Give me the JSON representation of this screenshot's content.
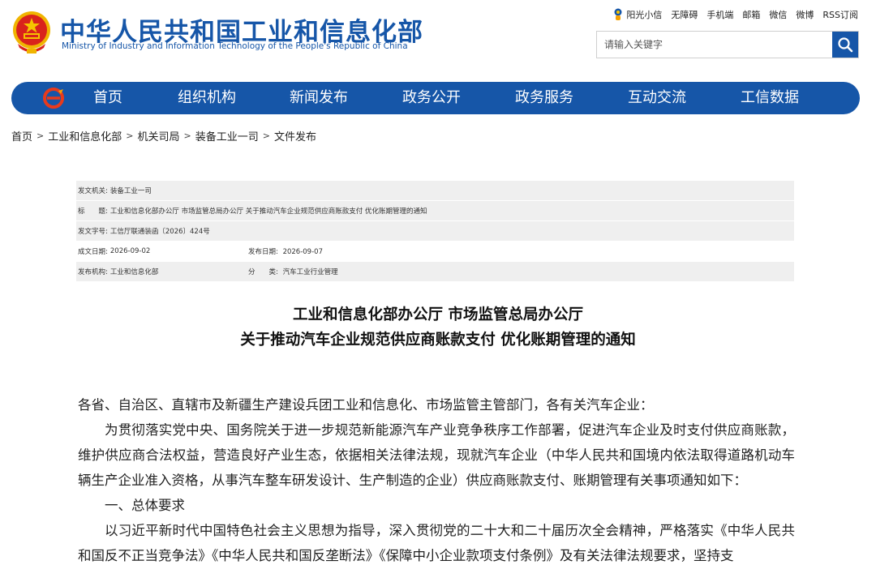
{
  "header": {
    "site_title": "中华人民共和国工业和信息化部",
    "site_subtitle": "Ministry of Industry and Information Technology of the People's Republic of China",
    "toplinks": [
      "阳光小信",
      "无障碍",
      "手机端",
      "邮箱",
      "微信",
      "微博",
      "RSS订阅"
    ],
    "search_placeholder": "请输入关键字"
  },
  "nav": {
    "items": [
      "首页",
      "组织机构",
      "新闻发布",
      "政务公开",
      "政务服务",
      "互动交流",
      "工信数据"
    ]
  },
  "breadcrumb": [
    "首页",
    "工业和信息化部",
    "机关司局",
    "装备工业一司",
    "文件发布"
  ],
  "meta": {
    "issuer_label": "发文机关:",
    "issuer": "装备工业一司",
    "title_label": "标　　题:",
    "title": "工业和信息化部办公厅 市场监管总局办公厅 关于推动汽车企业规范供应商账款支付 优化账期管理的通知",
    "docno_label": "发文字号:",
    "docno": "工信厅联通装函〔2026〕424号",
    "created_label": "成文日期:",
    "created": "2026-09-02",
    "published_label": "发布日期:",
    "published": "2026-09-07",
    "org_label": "发布机构:",
    "org": "工业和信息化部",
    "category_label": "分　　类:",
    "category": "汽车工业行业管理"
  },
  "document": {
    "title_line1": "工业和信息化部办公厅 市场监管总局办公厅",
    "title_line2": "关于推动汽车企业规范供应商账款支付 优化账期管理的通知",
    "salutation": "各省、自治区、直辖市及新疆生产建设兵团工业和信息化、市场监管主管部门，各有关汽车企业：",
    "para1": "为贯彻落实党中央、国务院关于进一步规范新能源汽车产业竞争秩序工作部署，促进汽车企业及时支付供应商账款，维护供应商合法权益，营造良好产业生态，依据相关法律法规，现就汽车企业（中华人民共和国境内依法取得道路机动车辆生产企业准入资格，从事汽车整车研发设计、生产制造的企业）供应商账款支付、账期管理有关事项通知如下：",
    "section1": "一、总体要求",
    "para2": "以习近平新时代中国特色社会主义思想为指导，深入贯彻党的二十大和二十届历次全会精神，严格落实《中华人民共和国反不正当竞争法》《中华人民共和国反垄断法》《保障中小企业款项支付条例》及有关法律法规要求，坚持支"
  },
  "colors": {
    "brand_blue": "#1656a8",
    "meta_shade": "#efefef"
  }
}
